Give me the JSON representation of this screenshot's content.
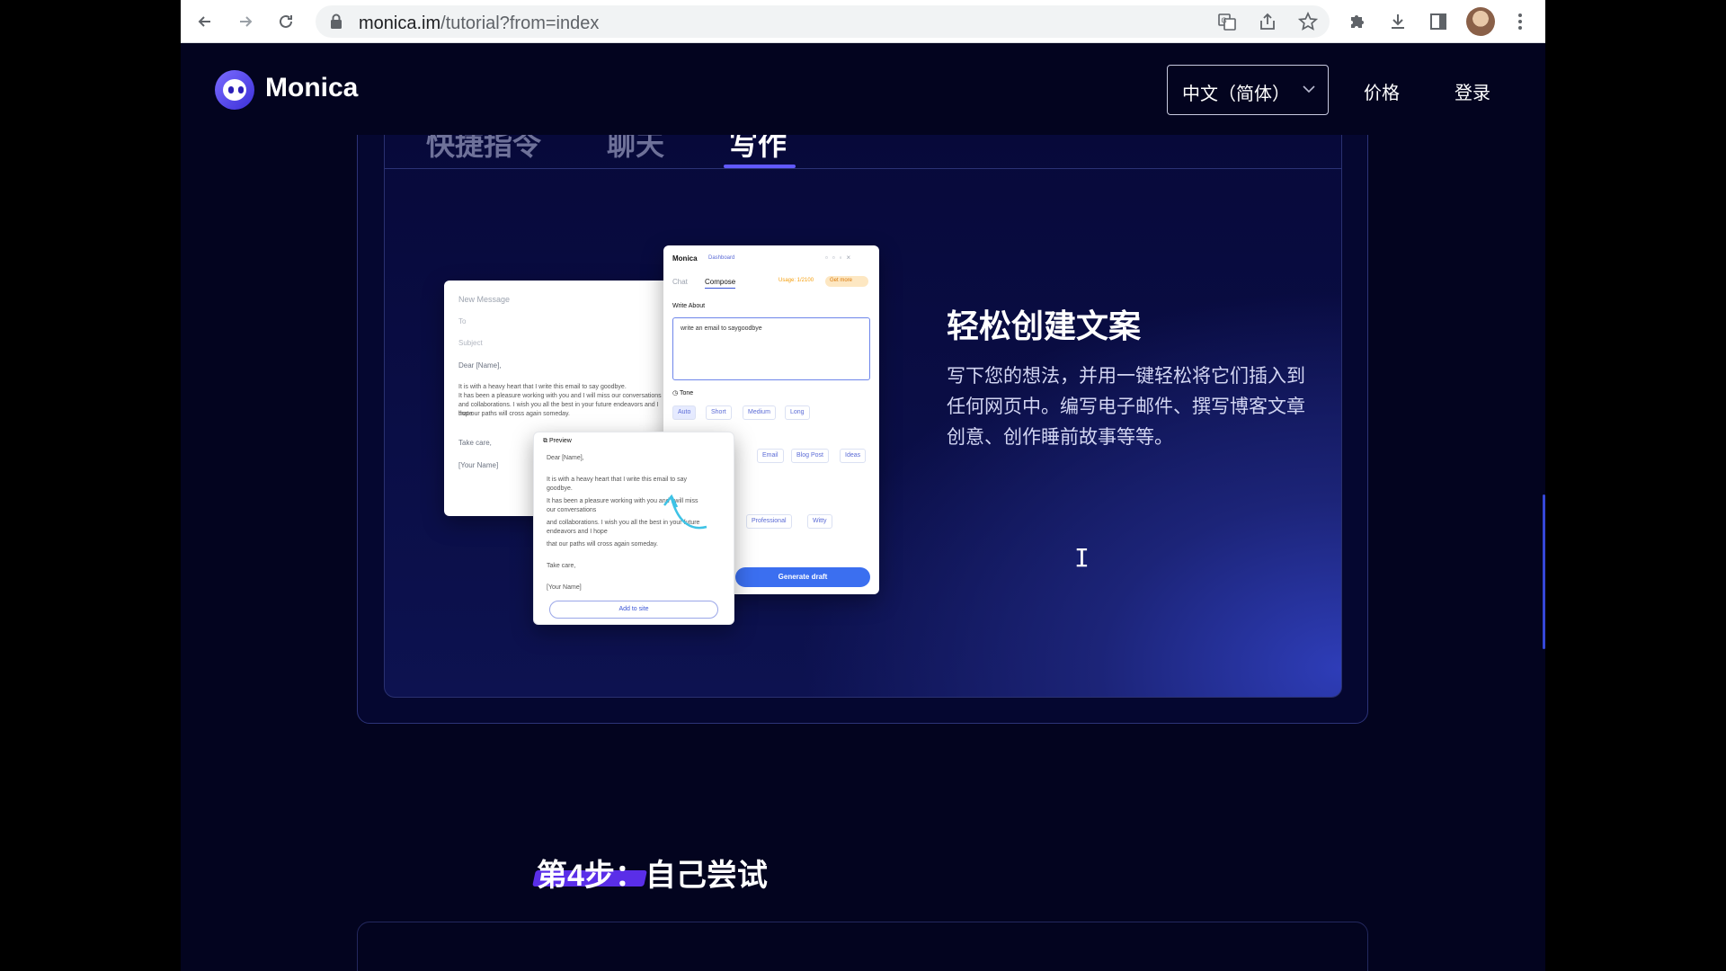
{
  "browser": {
    "url_host": "monica.im",
    "url_path": "/tutorial?from=index",
    "icons": [
      "back-icon",
      "forward-icon",
      "reload-icon",
      "lock-icon",
      "translate-icon",
      "share-icon",
      "bookmark-star-icon",
      "extensions-icon",
      "download-icon",
      "side-panel-icon",
      "profile-avatar",
      "more-icon"
    ]
  },
  "header": {
    "brand": "Monica",
    "language": "中文（简体）",
    "nav": [
      "价格",
      "登录"
    ]
  },
  "feature": {
    "tabs": [
      "快捷指令",
      "聊天",
      "写作"
    ],
    "active_tab": "写作",
    "title": "轻松创建文案",
    "description": "写下您的想法，并用一键轻松将它们插入到任何网页中。编写电子邮件、撰写博客文章创意、创作睡前故事等等。"
  },
  "illustration": {
    "email": {
      "heading": "New Message",
      "to": "To",
      "subject": "Subject",
      "greeting": "Dear [Name],",
      "body": [
        "It is with a heavy heart that I write this email to say goodbye.",
        "It has been a pleasure working with you and I will miss our conversations",
        "and collaborations. I wish you all the best in your future endeavors and I hope",
        "that our paths will cross again someday."
      ],
      "closing": "Take care,",
      "sign": "[Your Name]"
    },
    "panel": {
      "brand": "Monica",
      "dashboard": "Dashboard",
      "tabs": [
        "Chat",
        "Compose"
      ],
      "usage": "Usage: 1/2100",
      "get_more": "Get more",
      "write_about_label": "Write About",
      "write_about_value": "write an email to saygoodbye",
      "tone_label": "Tone",
      "length_options": [
        "Auto",
        "Short",
        "Medium",
        "Long"
      ],
      "format_options": [
        "Email",
        "Blog Post",
        "Ideas"
      ],
      "tone_options": [
        "Professional",
        "Witty"
      ],
      "generate": "Generate draft"
    },
    "preview": {
      "label": "Preview",
      "greeting": "Dear [Name],",
      "lines": [
        "It is with a heavy heart that I write this email to say",
        "goodbye.",
        "It has been a pleasure working with you and I will miss",
        "our conversations",
        "and collaborations. I wish you all the best in your future",
        "endeavors and I hope",
        "that our paths will cross again someday."
      ],
      "closing": "Take care,",
      "sign": "[Your Name]",
      "add_button": "Add to site"
    }
  },
  "step": {
    "prefix": "第4步：",
    "title": "自己尝试"
  },
  "colors": {
    "page_bg": "#03041f",
    "accent": "#6159ff",
    "highlight": "#5a2ee8",
    "button_blue": "#3b6ff0"
  }
}
